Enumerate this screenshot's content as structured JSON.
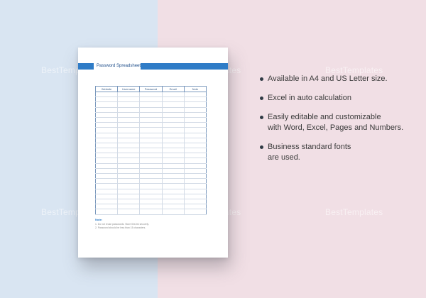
{
  "background": {
    "left_color": "#d9e5f2",
    "right_color": "#f1dfe5"
  },
  "watermarks": [
    "BestTemplates",
    "BestTemplates",
    "BestTemplates",
    "BestTemplates",
    "BestTemplates",
    "BestTemplates"
  ],
  "sheet": {
    "title": "Password Spreadsheet",
    "accent_color": "#2f7cc7",
    "columns": [
      "Website",
      "Username",
      "Password",
      "Email",
      "Note"
    ],
    "row_count": 24,
    "note_title": "Note:",
    "note_lines": [
      "1. Do not reuse passwords. Store this list securely.",
      "2. Password should be less than 15 characters."
    ]
  },
  "features": [
    "Available in A4 and US Letter size.",
    "Excel in auto calculation",
    "Easily editable and customizable\nwith Word, Excel, Pages and Numbers.",
    "Business standard fonts\nare used."
  ]
}
